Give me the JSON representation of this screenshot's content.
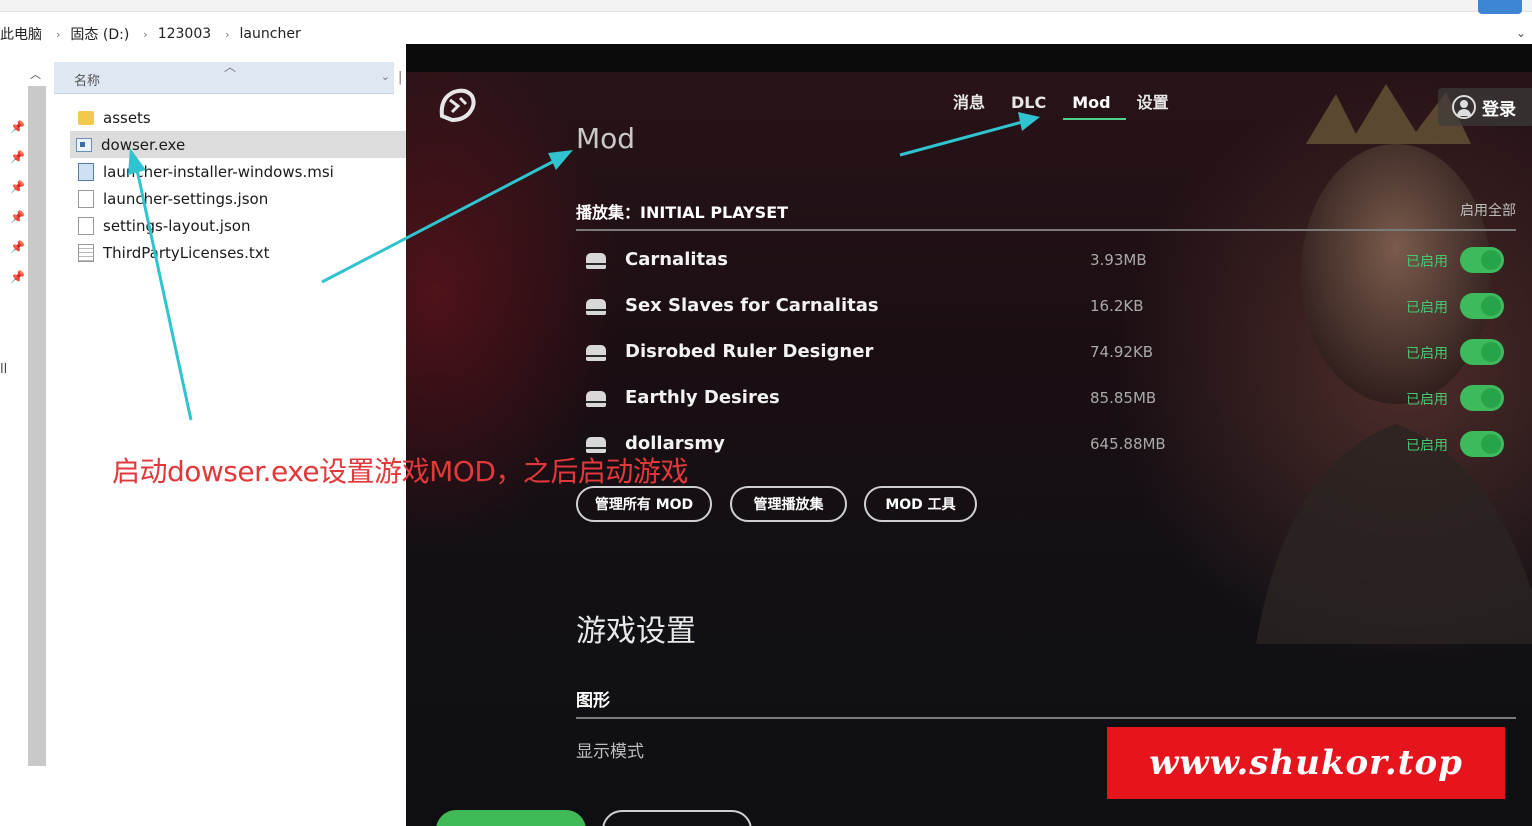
{
  "explorer": {
    "breadcrumb": [
      "此电脑",
      "固态 (D:)",
      "123003",
      "launcher"
    ],
    "column_name": "名称",
    "files": [
      {
        "name": "assets",
        "icon": "folder-icon"
      },
      {
        "name": "dowser.exe",
        "icon": "exe-icon",
        "selected": true
      },
      {
        "name": "launcher-installer-windows.msi",
        "icon": "msi-icon"
      },
      {
        "name": "launcher-settings.json",
        "icon": "file-icon"
      },
      {
        "name": "settings-layout.json",
        "icon": "file-icon"
      },
      {
        "name": "ThirdPartyLicenses.txt",
        "icon": "text-file-icon"
      }
    ]
  },
  "annotation": {
    "text": "启动dowser.exe设置游戏MOD，之后启动游戏",
    "color": "#e2383a",
    "arrow_color": "#2fc4cf"
  },
  "launcher": {
    "nav": {
      "tab_messages": "消息",
      "tab_dlc": "DLC",
      "tab_mod": "Mod",
      "tab_settings": "设置"
    },
    "login_label": "登录",
    "mod_section_title": "Mod",
    "playset_label": "播放集：INITIAL PLAYSET",
    "enable_all": "启用全部",
    "mods": [
      {
        "name": "Carnalitas",
        "size": "3.93MB",
        "status": "已启用",
        "enabled": true
      },
      {
        "name": "Sex Slaves for Carnalitas",
        "size": "16.2KB",
        "status": "已启用",
        "enabled": true
      },
      {
        "name": "Disrobed Ruler Designer",
        "size": "74.92KB",
        "status": "已启用",
        "enabled": true
      },
      {
        "name": "Earthly Desires",
        "size": "85.85MB",
        "status": "已启用",
        "enabled": true
      },
      {
        "name": "dollarsmy",
        "size": "645.88MB",
        "status": "已启用",
        "enabled": true
      }
    ],
    "buttons": {
      "manage_all_mods": "管理所有 MOD",
      "manage_playsets": "管理播放集",
      "mod_tools": "MOD 工具"
    },
    "game_settings_title": "游戏设置",
    "graphics_label": "图形",
    "display_mode_label": "显示模式",
    "accent_color": "#4fd18b",
    "enabled_color": "#46c872"
  },
  "watermark": {
    "text": "www.shukor.top",
    "color": "#e6141c"
  }
}
